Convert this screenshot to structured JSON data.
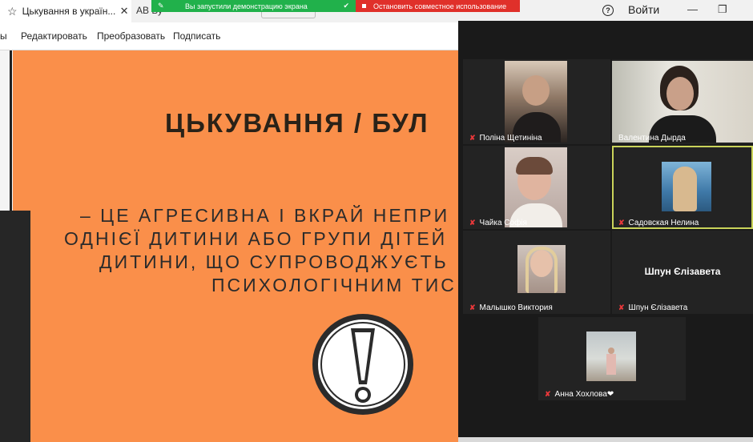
{
  "browser": {
    "active_tab_title": "Цькування в україн...",
    "second_tab_title": "AB Бу"
  },
  "share_bar": {
    "status_text": "Вы запустили демонстрацию экрана",
    "stop_text": "Остановить совместное использование"
  },
  "window": {
    "help": "?",
    "login_label": "Войти"
  },
  "menu": {
    "items": [
      "ы",
      "Редактировать",
      "Преобразовать",
      "Подписать"
    ]
  },
  "slide": {
    "title": "ЦЬКУВАННЯ / БУЛ",
    "body_lines": [
      "– ЦЕ АГРЕСИВНА І ВКРАЙ НЕПРИ",
      "ОДНІЄЇ ДИТИНИ АБО ГРУПИ ДІТЕЙ",
      "ДИТИНИ, ЩО СУПРОВОДЖУЄТЬ",
      "ПСИХОЛОГІЧНИМ ТИС"
    ]
  },
  "participants": [
    {
      "name": "Поліна Щетиніна",
      "muted": true,
      "video": true
    },
    {
      "name": "Валентина Дырда",
      "muted": false,
      "video": true
    },
    {
      "name": "Чайка Софія",
      "muted": true,
      "video": true
    },
    {
      "name": "Садовская Нелина",
      "muted": true,
      "video": true,
      "active_speaker": true
    },
    {
      "name": "Малышко Виктория",
      "muted": true,
      "video": true
    },
    {
      "name": "Шпун Єлізавета",
      "muted": true,
      "video": false,
      "display_name": "Шпун Єлізавета"
    },
    {
      "name": "Анна Хохлова❤",
      "muted": true,
      "video": true
    }
  ],
  "colors": {
    "slide_bg": "#fa8f4a",
    "share_green": "#21b14b",
    "share_red": "#e0302a",
    "active_outline": "#c9d35a",
    "mute_red": "#e8383a"
  }
}
